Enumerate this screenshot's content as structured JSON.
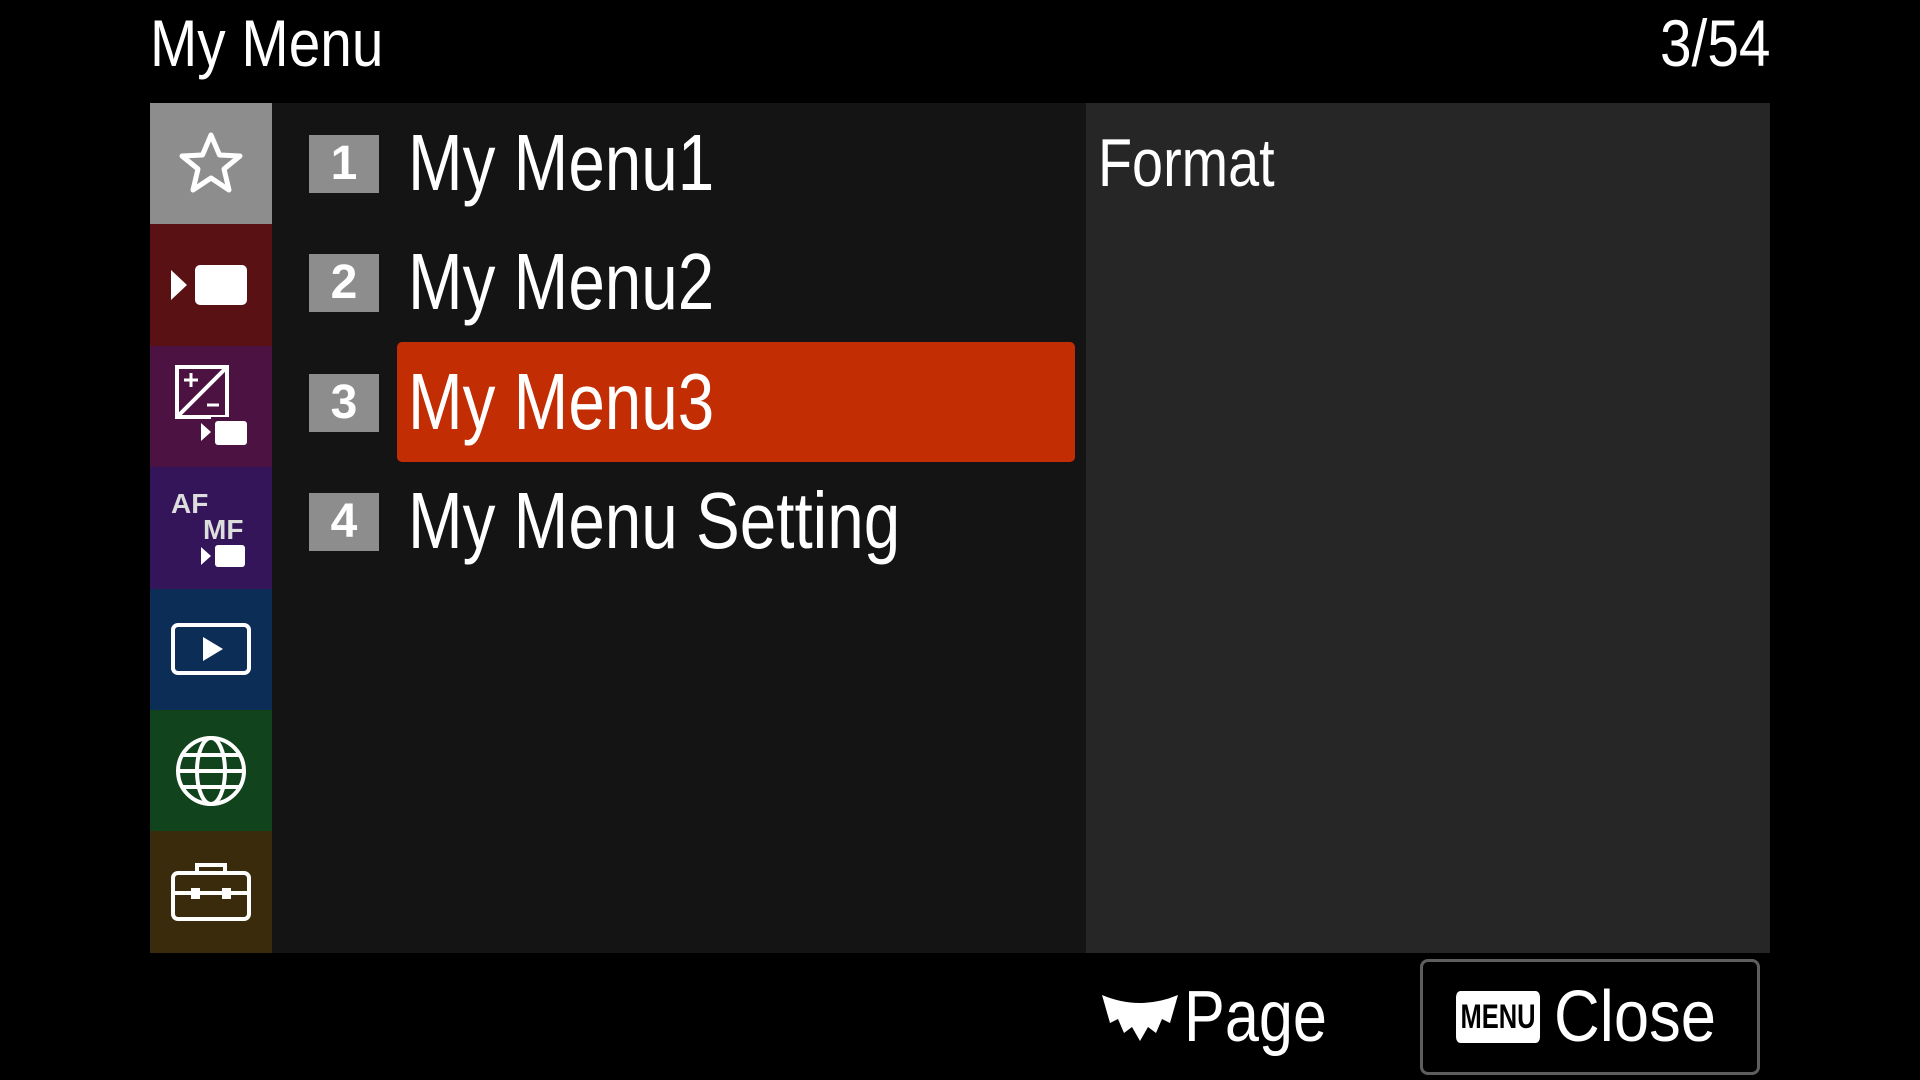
{
  "header": {
    "title": "My Menu",
    "page_counter": "3/54"
  },
  "tabs": [
    {
      "icon": "star-icon",
      "color": "#8d8d8d"
    },
    {
      "icon": "movie-camera-icon",
      "color": "#5a1114"
    },
    {
      "icon": "exposure-icon",
      "color": "#4b1242"
    },
    {
      "icon": "af-mf-icon",
      "color": "#341559"
    },
    {
      "icon": "playback-icon",
      "color": "#0c2d55"
    },
    {
      "icon": "globe-icon",
      "color": "#11441c"
    },
    {
      "icon": "toolbox-icon",
      "color": "#3a2b0c"
    }
  ],
  "menu": {
    "items": [
      {
        "number": "1",
        "label": "My Menu1"
      },
      {
        "number": "2",
        "label": "My Menu2"
      },
      {
        "number": "3",
        "label": "My Menu3"
      },
      {
        "number": "4",
        "label": "My Menu Setting"
      }
    ],
    "selected_index": 2,
    "highlight_color": "#c22d03"
  },
  "preview": {
    "items": [
      "Format"
    ]
  },
  "footer": {
    "page_label": "Page",
    "close_key": "MENU",
    "close_label": "Close"
  }
}
